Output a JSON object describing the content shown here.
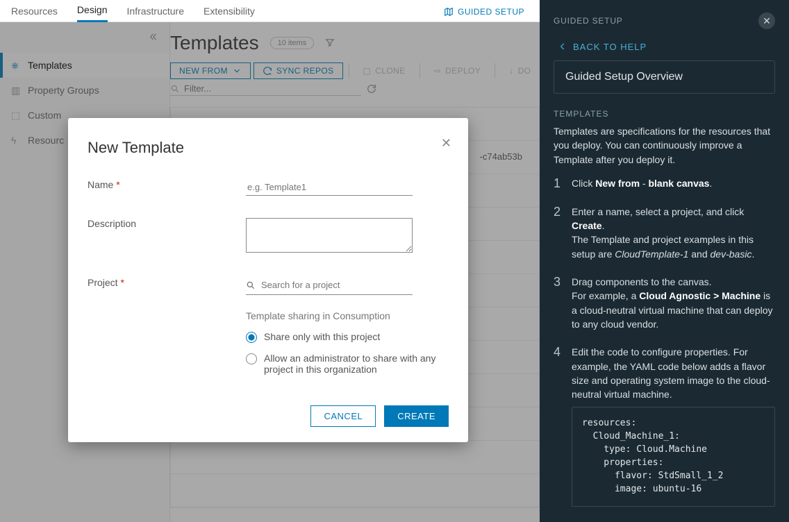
{
  "tabs": {
    "resources": "Resources",
    "design": "Design",
    "infrastructure": "Infrastructure",
    "extensibility": "Extensibility",
    "guided": "GUIDED SETUP"
  },
  "sidebar": {
    "templates": "Templates",
    "property_groups": "Property Groups",
    "custom": "Custom",
    "resource": "Resourc"
  },
  "page": {
    "title": "Templates",
    "count_label": "10 items"
  },
  "toolbar": {
    "new_from": "NEW FROM",
    "sync": "SYNC REPOS",
    "clone": "CLONE",
    "deploy": "DEPLOY",
    "download": "DO"
  },
  "filter": {
    "placeholder": "Filter..."
  },
  "table": {
    "snippet": "-c74ab53b"
  },
  "modal": {
    "title": "New Template",
    "name_label": "Name",
    "name_placeholder": "e.g. Template1",
    "desc_label": "Description",
    "project_label": "Project",
    "project_placeholder": "Search for a project",
    "share_title": "Template sharing in Consumption",
    "share_opt1": "Share only with this project",
    "share_opt2": "Allow an administrator to share with any project in this organization",
    "cancel": "CANCEL",
    "create": "CREATE"
  },
  "panel": {
    "title": "GUIDED SETUP",
    "back": "BACK TO HELP",
    "overview": "Guided Setup Overview",
    "section": "TEMPLATES",
    "intro": "Templates are specifications for the resources that you deploy. You can continuously improve a Template after you deploy it.",
    "s1a": "Click ",
    "s1b": "New from",
    "s1c": " - ",
    "s1d": "blank canvas",
    "s1e": ".",
    "s2a": "Enter a name, select a project, and click ",
    "s2b": "Create",
    "s2c": ".",
    "s2d": "The Template and project examples in this setup are ",
    "s2e": "CloudTemplate-1",
    "s2f": " and ",
    "s2g": "dev-basic",
    "s2h": ".",
    "s3a": "Drag components to the canvas.",
    "s3b": "For example, a ",
    "s3c": "Cloud Agnostic > Machine",
    "s3d": " is a cloud-neutral virtual machine that can deploy to any cloud vendor.",
    "s4a": "Edit the code to configure properties. For example, the YAML code below adds a flavor size and operating system image to the cloud-neutral virtual machine.",
    "code": "resources:\n  Cloud_Machine_1:\n    type: Cloud.Machine\n    properties:\n      flavor: StdSmall_1_2\n      image: ubuntu-16"
  }
}
